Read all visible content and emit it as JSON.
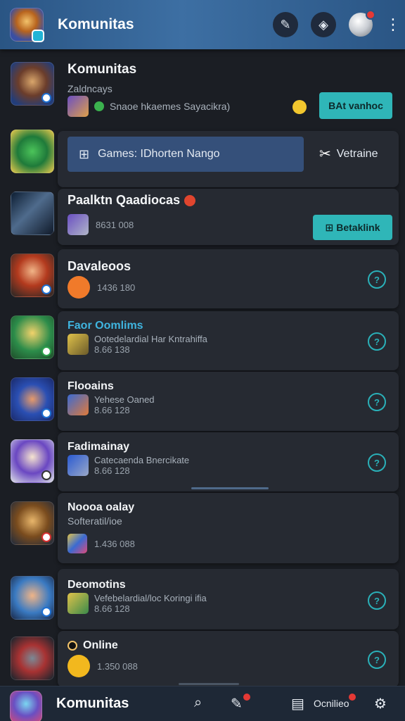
{
  "header": {
    "title": "Komunitas",
    "icons": [
      "edit-icon",
      "gamepad-icon",
      "profile-avatar",
      "more-icon"
    ]
  },
  "community": {
    "title": "Komunitas",
    "subtitle": "Zaldncays",
    "line": "Snaoe hkaemes Sayacikra)",
    "join_label": "BAt vanhoc"
  },
  "games_filter": {
    "label": "Games: IDhorten Nango",
    "right_label": "Vetraine"
  },
  "featured": {
    "title": "Paalktn Qaadiocas",
    "count": "8631 008",
    "button_label": "Betaklink"
  },
  "list": [
    {
      "title": "Davaleoos",
      "meta": "",
      "count": "1436 180"
    },
    {
      "title": "Faor Oomlims",
      "meta": "Ootedelardial Har Kntrahiffa",
      "count": "8.66 138"
    },
    {
      "title": "Flooains",
      "meta": "Yehese Oaned",
      "count": "8.66 128"
    },
    {
      "title": "Fadimainay",
      "meta": "Catecaenda Bnercikate",
      "count": "8.66 128"
    },
    {
      "title": "Noooa oalay",
      "meta": "Softeratil/ioe",
      "count": "1.436 088"
    },
    {
      "title": "Deomotins",
      "meta": "Vefebelardial/loc Koringi ifia",
      "count": "8.66 128"
    },
    {
      "title": "Online",
      "meta": "",
      "count": "1.350 088"
    }
  ],
  "bottom_nav": {
    "title": "Komunitas",
    "messages_label": "Ocnilieo"
  },
  "colors": {
    "accent": "#2fb6b8",
    "header": "#2a5584",
    "badge": "#e53935"
  }
}
